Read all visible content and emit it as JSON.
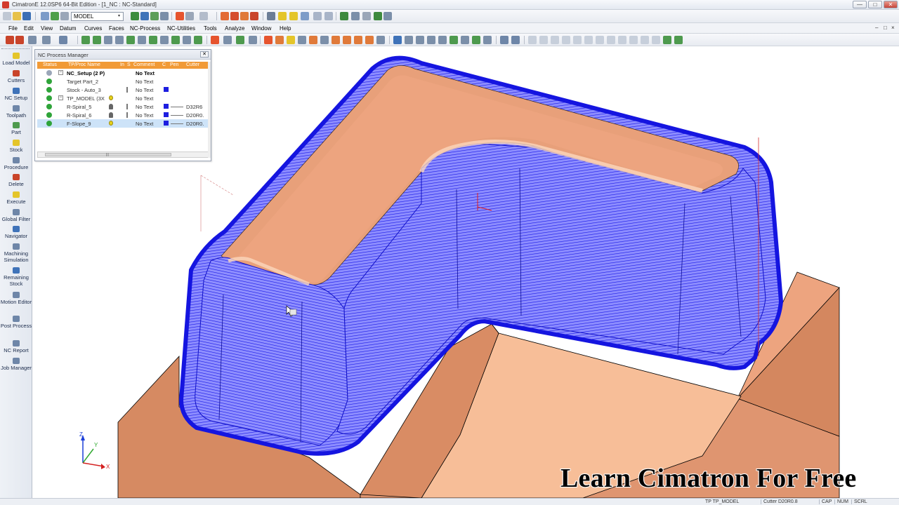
{
  "window": {
    "title": "CimatronE 12.0SP6  64-Bit Edition - [1_NC : NC-Standard]",
    "minimize_label": "—",
    "maximize_label": "□",
    "close_label": "✕"
  },
  "toolbar": {
    "model_combo_value": "MODEL",
    "combo_arrow": "▾"
  },
  "menu": {
    "items": [
      "File",
      "Edit",
      "View",
      "Datum",
      "Curves",
      "Faces",
      "NC-Process",
      "NC-Utilities",
      "Tools",
      "Analyze",
      "Window",
      "Help"
    ],
    "doc_controls": [
      "–",
      "□",
      "×"
    ]
  },
  "left_panel": {
    "items": [
      {
        "label": "Load Model"
      },
      {
        "label": "Cutters"
      },
      {
        "label": "NC Setup"
      },
      {
        "label": "Toolpath"
      },
      {
        "label": "Part"
      },
      {
        "label": "Stock"
      },
      {
        "label": "Procedure"
      },
      {
        "label": "Delete"
      },
      {
        "label": "Execute"
      },
      {
        "label": "Global Filter"
      },
      {
        "label": "Navigator"
      },
      {
        "label": "Machining Simulation"
      },
      {
        "label": "Remaining Stock"
      },
      {
        "label": "Motion Editor"
      },
      {
        "label": "Post Process"
      },
      {
        "label": "NC Report"
      },
      {
        "label": "Job Manager"
      }
    ]
  },
  "nc_process_manager": {
    "title": "NC Process Manager",
    "close_label": "✕",
    "columns": [
      "Status",
      "TP/Proc Name",
      "In",
      "S",
      "Comment",
      "C",
      "Pen",
      "Cutter"
    ],
    "rows": [
      {
        "name": "NC_Setup (2 P)",
        "comment": "No Text",
        "expand": "−",
        "bold": true
      },
      {
        "name": "Target Part_2",
        "comment": "No Text"
      },
      {
        "name": "Stock - Auto_3",
        "comment": "No Text"
      },
      {
        "name": "TP_MODEL (3X",
        "comment": "No Text",
        "expand": "−"
      },
      {
        "name": "R-Spiral_5",
        "comment": "No Text",
        "cutter": "D32R6"
      },
      {
        "name": "R-Spiral_6",
        "comment": "No Text",
        "cutter": "D20R0."
      },
      {
        "name": "F-Slope_9",
        "comment": "No Text",
        "cutter": "D20R0."
      }
    ],
    "scroll_marker": "|||"
  },
  "viewport": {
    "axis_labels": {
      "x": "X",
      "y": "Y",
      "z": "Z"
    }
  },
  "status_bar": {
    "toolpath": "TP  TP_MODEL",
    "cutter": "Cutter  D20R0.8",
    "caps": "CAP",
    "num": "NUM",
    "scrl": "SCRL"
  },
  "watermark": "Learn Cimatron For Free",
  "colors": {
    "toolpath_blue": "#1a1ae6",
    "part_orange": "#e8a07a",
    "part_light": "#f5b68f",
    "column_header": "#f19a36"
  }
}
